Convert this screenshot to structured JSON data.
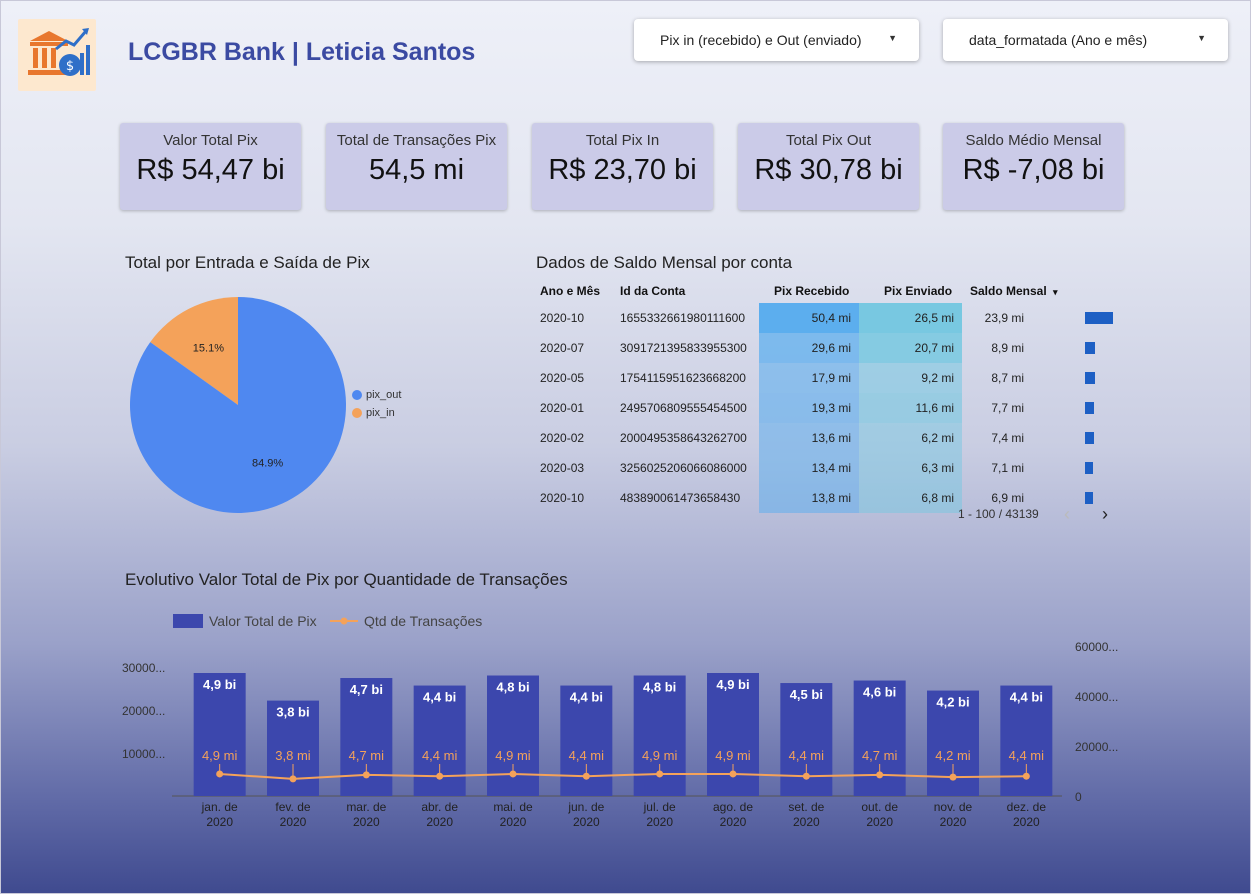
{
  "header": {
    "title": "LCGBR Bank | Leticia Santos",
    "logo_icon": "bank-growth-icon",
    "filter1": "Pix in (recebido) e Out (enviado)",
    "filter2": "data_formatada (Ano e mês)"
  },
  "kpis": [
    {
      "label": "Valor Total Pix",
      "value": "R$ 54,47 bi"
    },
    {
      "label": "Total de Transações Pix",
      "value": "54,5 mi"
    },
    {
      "label": "Total Pix In",
      "value": "R$ 23,70 bi"
    },
    {
      "label": "Total Pix Out",
      "value": "R$ 30,78 bi"
    },
    {
      "label": "Saldo Médio Mensal",
      "value": "R$ -7,08 bi"
    }
  ],
  "pie": {
    "title": "Total por Entrada e Saída de Pix",
    "slices": [
      {
        "name": "pix_out",
        "label": "84.9%",
        "value": 84.9,
        "color": "#4f88f0"
      },
      {
        "name": "pix_in",
        "label": "15.1%",
        "value": 15.1,
        "color": "#f4a25a"
      }
    ]
  },
  "table": {
    "title": "Dados de Saldo Mensal por conta",
    "columns": [
      "Ano e Mês",
      "Id da Conta",
      "Pix Recebido",
      "Pix Enviado",
      "Saldo Mensal"
    ],
    "sort_indicator": "▾",
    "rows": [
      {
        "ano_mes": "2020-10",
        "id": "1655332661980111600",
        "recebido": "50,4 mi",
        "enviado": "26,5 mi",
        "saldo": "23,9 mi",
        "recebido_num": 50.4,
        "enviado_num": 26.5,
        "saldo_num": 23.9
      },
      {
        "ano_mes": "2020-07",
        "id": "3091721395833955300",
        "recebido": "29,6 mi",
        "enviado": "20,7 mi",
        "saldo": "8,9 mi",
        "recebido_num": 29.6,
        "enviado_num": 20.7,
        "saldo_num": 8.9
      },
      {
        "ano_mes": "2020-05",
        "id": "1754115951623668200",
        "recebido": "17,9 mi",
        "enviado": "9,2 mi",
        "saldo": "8,7 mi",
        "recebido_num": 17.9,
        "enviado_num": 9.2,
        "saldo_num": 8.7
      },
      {
        "ano_mes": "2020-01",
        "id": "2495706809555454500",
        "recebido": "19,3 mi",
        "enviado": "11,6 mi",
        "saldo": "7,7 mi",
        "recebido_num": 19.3,
        "enviado_num": 11.6,
        "saldo_num": 7.7
      },
      {
        "ano_mes": "2020-02",
        "id": "2000495358643262700",
        "recebido": "13,6 mi",
        "enviado": "6,2 mi",
        "saldo": "7,4 mi",
        "recebido_num": 13.6,
        "enviado_num": 6.2,
        "saldo_num": 7.4
      },
      {
        "ano_mes": "2020-03",
        "id": "3256025206066086000",
        "recebido": "13,4 mi",
        "enviado": "6,3 mi",
        "saldo": "7,1 mi",
        "recebido_num": 13.4,
        "enviado_num": 6.3,
        "saldo_num": 7.1
      },
      {
        "ano_mes": "2020-10",
        "id": "483890061473658430",
        "recebido": "13,8 mi",
        "enviado": "6,8 mi",
        "saldo": "6,9 mi",
        "recebido_num": 13.8,
        "enviado_num": 6.8,
        "saldo_num": 6.9
      }
    ],
    "pagination": "1 - 100 / 43139",
    "prev_icon": "‹",
    "next_icon": "›"
  },
  "combo": {
    "title": "Evolutivo Valor Total de Pix por Quantidade de Transações",
    "left_ticks": [
      "30000...",
      "20000...",
      "10000..."
    ],
    "right_ticks": [
      "60000...",
      "40000...",
      "20000...",
      "0"
    ]
  },
  "chart_data": {
    "type": "bar",
    "title": "Evolutivo Valor Total de Pix por Quantidade de Transações",
    "categories": [
      "jan. de 2020",
      "fev. de 2020",
      "mar. de 2020",
      "abr. de 2020",
      "mai. de 2020",
      "jun. de 2020",
      "jul. de 2020",
      "ago. de 2020",
      "set. de 2020",
      "out. de 2020",
      "nov. de 2020",
      "dez. de 2020"
    ],
    "category_lines": [
      [
        "jan. de",
        "2020"
      ],
      [
        "fev. de",
        "2020"
      ],
      [
        "mar. de",
        "2020"
      ],
      [
        "abr. de",
        "2020"
      ],
      [
        "mai. de",
        "2020"
      ],
      [
        "jun. de",
        "2020"
      ],
      [
        "jul. de",
        "2020"
      ],
      [
        "ago. de",
        "2020"
      ],
      [
        "set. de",
        "2020"
      ],
      [
        "out. de",
        "2020"
      ],
      [
        "nov. de",
        "2020"
      ],
      [
        "dez. de",
        "2020"
      ]
    ],
    "series": [
      {
        "name": "Valor Total de Pix",
        "type": "bar",
        "color": "#3c47ad",
        "axis": "right",
        "values": [
          4.9,
          3.8,
          4.7,
          4.4,
          4.8,
          4.4,
          4.8,
          4.9,
          4.5,
          4.6,
          4.2,
          4.4
        ],
        "labels": [
          "4,9 bi",
          "3,8 bi",
          "4,7 bi",
          "4,4 bi",
          "4,8 bi",
          "4,4 bi",
          "4,8 bi",
          "4,9 bi",
          "4,5 bi",
          "4,6 bi",
          "4,2 bi",
          "4,4 bi"
        ]
      },
      {
        "name": "Qtd de Transações",
        "type": "line",
        "color": "#f4a25a",
        "axis": "left",
        "values": [
          4.9,
          3.8,
          4.7,
          4.4,
          4.9,
          4.4,
          4.9,
          4.9,
          4.4,
          4.7,
          4.2,
          4.4
        ],
        "labels": [
          "4,9 mi",
          "3,8 mi",
          "4,7 mi",
          "4,4 mi",
          "4,9 mi",
          "4,4 mi",
          "4,9 mi",
          "4,9 mi",
          "4,4 mi",
          "4,7 mi",
          "4,2 mi",
          "4,4 mi"
        ]
      }
    ]
  }
}
